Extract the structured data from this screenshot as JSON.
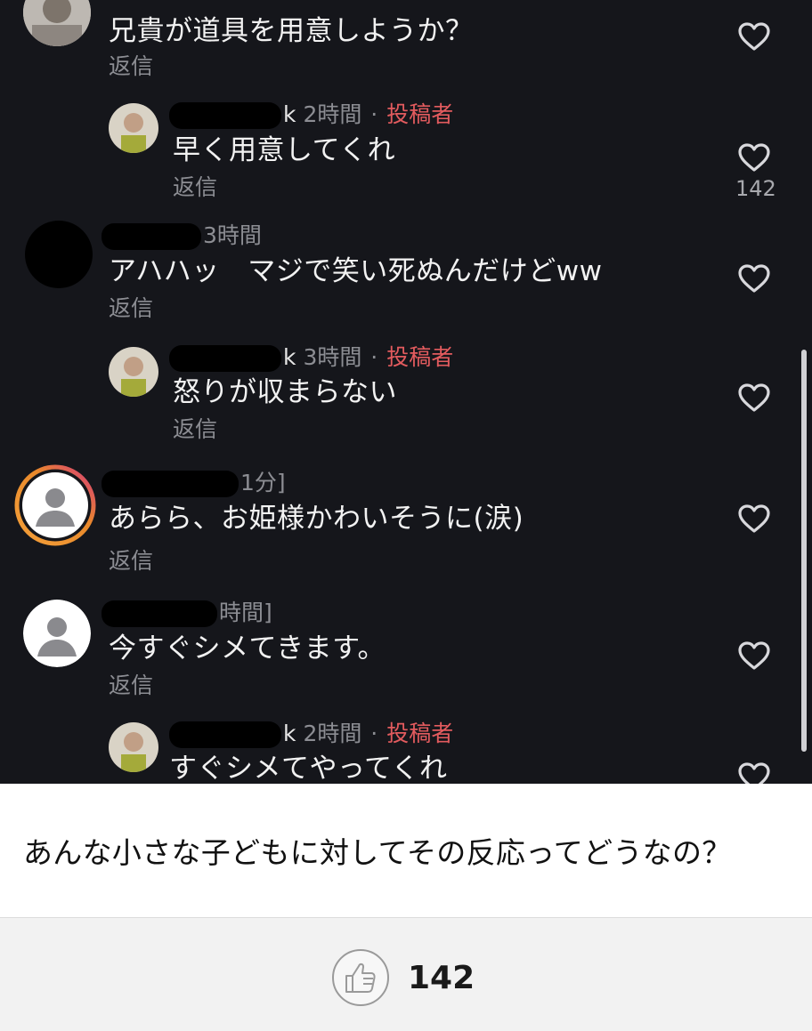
{
  "comments": [
    {
      "text": "兄貴が道具を用意しようか？",
      "reply": "返信"
    },
    {
      "handle_tail": "k",
      "time": "2時間",
      "sep": "·",
      "author_badge": "投稿者",
      "text": "早く用意してくれ",
      "reply": "返信",
      "likes": "142"
    },
    {
      "time": "3時間",
      "text": "アハハッ　マジで笑い死ぬんだけどww",
      "reply": "返信"
    },
    {
      "handle_tail": "k",
      "time": "3時間",
      "sep": "·",
      "author_badge": "投稿者",
      "text": "怒りが収まらない",
      "reply": "返信"
    },
    {
      "time": "1分]",
      "text": "あらら、お姫様かわいそうに(涙)",
      "reply": "返信"
    },
    {
      "time": "時間]",
      "text": "今すぐシメてきます。",
      "reply": "返信"
    },
    {
      "handle_tail": "k",
      "time": "2時間",
      "sep": "·",
      "author_badge": "投稿者",
      "text": "すぐシメてやってくれ"
    }
  ],
  "caption": "あんな小さな子どもに対してその反応ってどうなの？",
  "footer": {
    "like_count": "142"
  },
  "icons": {
    "like": "heart-outline-icon",
    "thumb": "thumbs-up-icon"
  },
  "colors": {
    "background": "#15161b",
    "author_badge": "#e25b5e",
    "meta": "#8c8d93",
    "story_ring": "#e9892b"
  }
}
